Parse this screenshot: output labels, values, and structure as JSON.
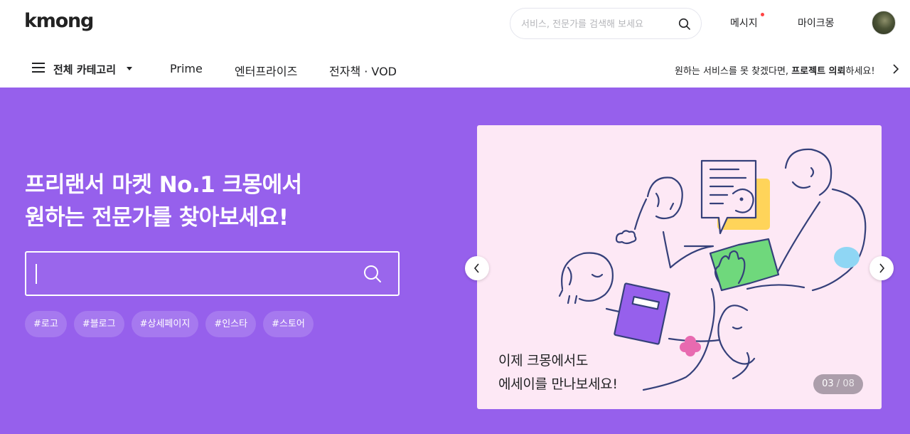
{
  "header": {
    "logo": "kmong",
    "search_placeholder": "서비스, 전문가를 검색해 보세요",
    "message_label": "메시지",
    "mykmong_label": "마이크몽"
  },
  "subnav": {
    "all_categories": "전체 카테고리",
    "links": [
      "Prime",
      "엔터프라이즈",
      "전자책 · VOD"
    ],
    "project_cta_prefix": "원하는 서비스를 못 찾겠다면, ",
    "project_cta_bold": "프로젝트 의뢰",
    "project_cta_suffix": "하세요!"
  },
  "hero": {
    "title_line1": "프리랜서 마켓 No.1 크몽에서",
    "title_line2": "원하는 전문가를 찾아보세요!",
    "search_value": "",
    "tags": [
      "#로고",
      "#블로그",
      "#상세페이지",
      "#인스타",
      "#스토어"
    ]
  },
  "banner": {
    "line1": "이제 크몽에서도",
    "line2": "에세이를 만나보세요!",
    "current": "03",
    "separator": " / ",
    "total": "08"
  },
  "icons": {
    "search": "search-icon",
    "menu": "hamburger-icon",
    "caret": "caret-down-icon",
    "chevron": "chevron-right-icon",
    "prev": "chevron-left-icon",
    "next": "chevron-right-icon"
  },
  "colors": {
    "hero_bg": "#9660ec",
    "banner_bg": "#fde8f5",
    "notification_dot": "#ff4444"
  }
}
